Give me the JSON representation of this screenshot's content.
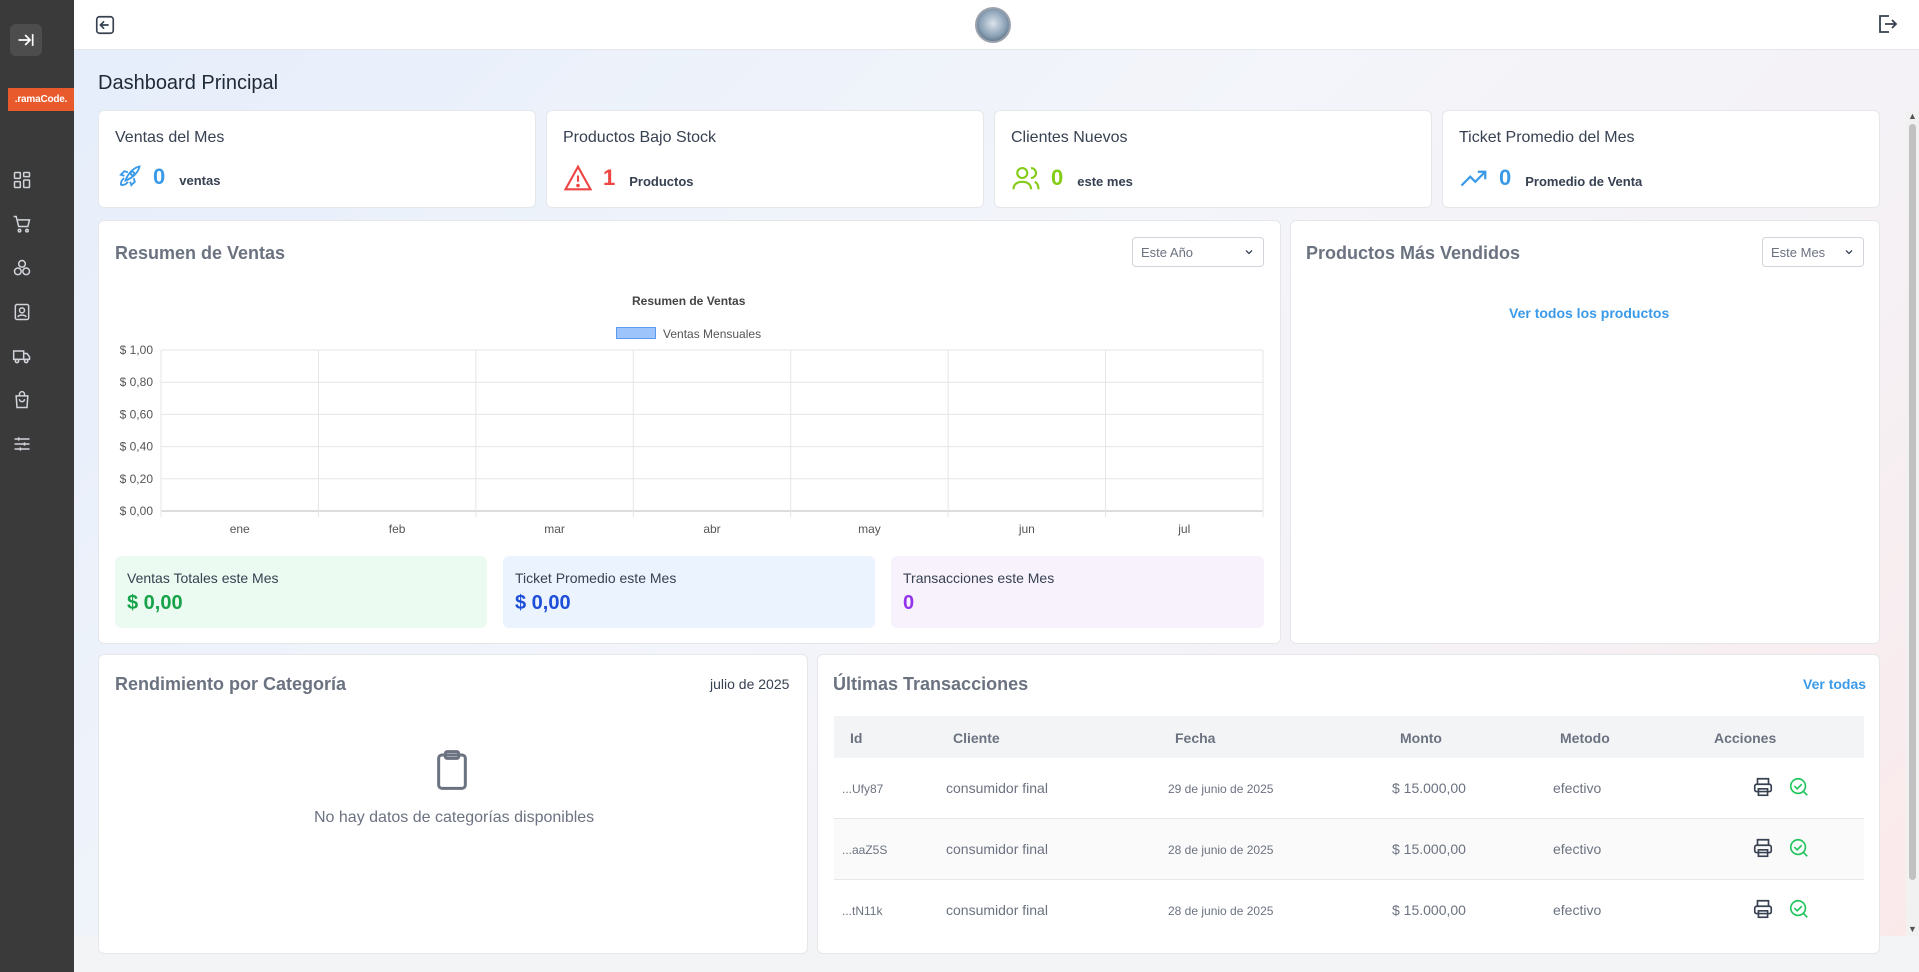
{
  "brand": {
    "logo_text": ".ramaCode."
  },
  "sidebar": {
    "items": [
      {
        "name": "dashboard",
        "icon": "grid-icon"
      },
      {
        "name": "sales",
        "icon": "cart-icon"
      },
      {
        "name": "products",
        "icon": "boxes-icon"
      },
      {
        "name": "customers",
        "icon": "contact-card-icon"
      },
      {
        "name": "suppliers",
        "icon": "truck-icon"
      },
      {
        "name": "purchases",
        "icon": "bag-icon"
      },
      {
        "name": "settings",
        "icon": "sliders-icon"
      }
    ]
  },
  "page": {
    "title": "Dashboard Principal"
  },
  "stats": [
    {
      "label": "Ventas del Mes",
      "value": "0",
      "sub": "ventas",
      "color": "#3b9ae8",
      "icon": "rocket-icon"
    },
    {
      "label": "Productos Bajo Stock",
      "value": "1",
      "sub": "Productos",
      "color": "#ef4444",
      "icon": "warning-icon"
    },
    {
      "label": "Clientes Nuevos",
      "value": "0",
      "sub": "este mes",
      "color": "#84cc16",
      "icon": "users-icon"
    },
    {
      "label": "Ticket Promedio del Mes",
      "value": "0",
      "sub": "Promedio de Venta",
      "color": "#3b9ae8",
      "icon": "trending-up-icon"
    }
  ],
  "sales_summary": {
    "title": "Resumen de Ventas",
    "period": "Este Año",
    "kpis": [
      {
        "label": "Ventas Totales este Mes",
        "value": "$ 0,00",
        "color": "#16a34a",
        "bg": "#ecfbf1"
      },
      {
        "label": "Ticket Promedio este Mes",
        "value": "$ 0,00",
        "color": "#1d4ed8",
        "bg": "#ebf3fe"
      },
      {
        "label": "Transacciones este Mes",
        "value": "0",
        "color": "#9333ea",
        "bg": "#f8f2fd"
      }
    ]
  },
  "chart_data": {
    "type": "bar",
    "title": "Resumen de Ventas",
    "categories": [
      "ene",
      "feb",
      "mar",
      "abr",
      "may",
      "jun",
      "jul"
    ],
    "series": [
      {
        "name": "Ventas Mensuales",
        "values": [
          0,
          0,
          0,
          0,
          0,
          0,
          0
        ]
      }
    ],
    "ylim": [
      0,
      1
    ],
    "yticks": [
      "$ 1,00",
      "$ 0,80",
      "$ 0,60",
      "$ 0,40",
      "$ 0,20",
      "$ 0,00"
    ],
    "grid": true,
    "legend": "top",
    "colors": {
      "fill": "#9ec5fb",
      "stroke": "#5b9cf2"
    }
  },
  "top_products": {
    "title": "Productos Más Vendidos",
    "period": "Este Mes",
    "link": "Ver todos los productos"
  },
  "category_perf": {
    "title": "Rendimiento por Categoría",
    "date": "julio de 2025",
    "empty": "No hay datos de categorías disponibles"
  },
  "transactions": {
    "title": "Últimas Transacciones",
    "view_all": "Ver todas",
    "columns": [
      "Id",
      "Cliente",
      "Fecha",
      "Monto",
      "Metodo",
      "Acciones"
    ],
    "rows": [
      {
        "id": "...Ufy87",
        "client": "consumidor final",
        "date": "29 de junio de 2025",
        "amount": "$ 15.000,00",
        "method": "efectivo"
      },
      {
        "id": "...aaZ5S",
        "client": "consumidor final",
        "date": "28 de junio de 2025",
        "amount": "$ 15.000,00",
        "method": "efectivo"
      },
      {
        "id": "...tN11k",
        "client": "consumidor final",
        "date": "28 de junio de 2025",
        "amount": "$ 15.000,00",
        "method": "efectivo"
      }
    ]
  }
}
